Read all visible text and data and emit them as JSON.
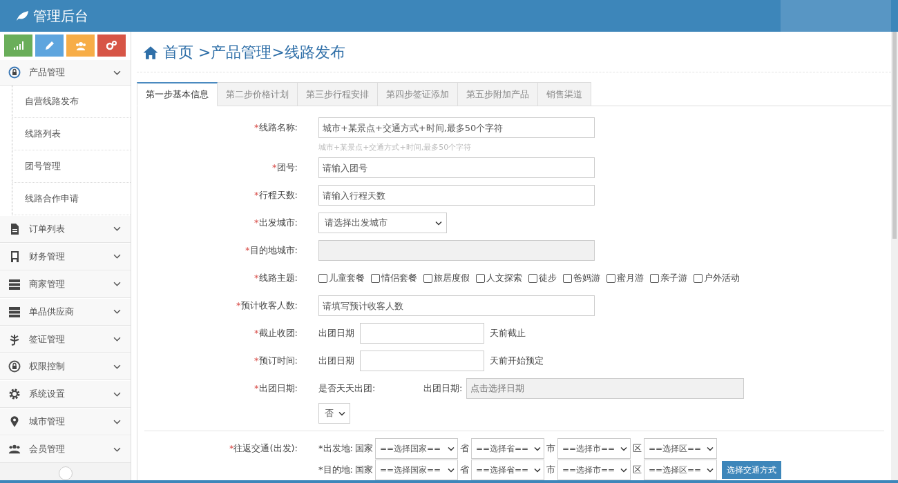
{
  "header": {
    "title": "管理后台"
  },
  "breadcrumb": "首页 >产品管理>线路发布",
  "sidebar": {
    "items": [
      {
        "label": "产品管理",
        "expanded": true,
        "children": [
          {
            "label": "自营线路发布"
          },
          {
            "label": "线路列表"
          },
          {
            "label": "团号管理"
          },
          {
            "label": "线路合作申请"
          }
        ]
      },
      {
        "label": "订单列表",
        "expanded": false
      },
      {
        "label": "财务管理",
        "expanded": false
      },
      {
        "label": "商家管理",
        "expanded": false
      },
      {
        "label": "单品供应商",
        "expanded": false
      },
      {
        "label": "签证管理",
        "expanded": false
      },
      {
        "label": "权限控制",
        "expanded": false
      },
      {
        "label": "系统设置",
        "expanded": false
      },
      {
        "label": "城市管理",
        "expanded": false
      },
      {
        "label": "会员管理",
        "expanded": false
      }
    ]
  },
  "tabs": [
    {
      "label": "第一步基本信息",
      "selected": true
    },
    {
      "label": "第二步价格计划",
      "selected": false
    },
    {
      "label": "第三步行程安排",
      "selected": false
    },
    {
      "label": "第四步签证添加",
      "selected": false
    },
    {
      "label": "第五步附加产品",
      "selected": false
    },
    {
      "label": "销售渠道",
      "selected": false
    }
  ],
  "form": [
    {
      "kind": "text",
      "required": "*",
      "label": "线路名称:",
      "placeholder": "城市+某景点+交通方式+时间,最多50个字符",
      "hint": "城市+某景点+交通方式+时间,最多50个字符"
    },
    {
      "kind": "text",
      "required": "*",
      "label": "团号:",
      "placeholder": "请输入团号"
    },
    {
      "kind": "text",
      "required": "*",
      "label": "行程天数:",
      "placeholder": "请输入行程天数"
    },
    {
      "kind": "select",
      "required": "*",
      "label": "出发城市:",
      "value": "请选择出发城市"
    },
    {
      "kind": "disabled",
      "required": "*",
      "label": "目的地城市:"
    },
    {
      "kind": "checkboxes",
      "required": "*",
      "label": "线路主题:",
      "options": [
        {
          "label": "儿童套餐",
          "checked": false
        },
        {
          "label": "情侣套餐",
          "checked": false
        },
        {
          "label": "旅居度假",
          "checked": false
        },
        {
          "label": "人文探索",
          "checked": false
        },
        {
          "label": "徒步",
          "checked": false
        },
        {
          "label": "爸妈游",
          "checked": false
        },
        {
          "label": "蜜月游",
          "checked": false
        },
        {
          "label": "亲子游",
          "checked": false
        },
        {
          "label": "户外活动",
          "checked": false
        }
      ]
    },
    {
      "kind": "text",
      "required": "*",
      "label": "预计收客人数:",
      "placeholder": "请填写预计收客人数"
    },
    {
      "kind": "days",
      "required": "*",
      "label": "截止收团:",
      "prefix": "出团日期",
      "suffix": "天前截止"
    },
    {
      "kind": "days",
      "required": "*",
      "label": "预订时间:",
      "prefix": "出团日期",
      "suffix": "天前开始预定"
    },
    {
      "kind": "date",
      "required": "*",
      "label": "出团日期:",
      "daily_label": "是否天天出团:",
      "daily_value": "否",
      "date_label": "出团日期:",
      "date_placeholder": "点击选择日期"
    }
  ],
  "transport": {
    "required": "*",
    "label": "往返交通(出发):",
    "rows": [
      {
        "prefix": "*出发地:",
        "selects": [
          {
            "label": "国家",
            "value": "==选择国家=="
          },
          {
            "label": "省",
            "value": "==选择省=="
          },
          {
            "label": "市",
            "value": "==选择市=="
          },
          {
            "label": "区",
            "value": "==选择区=="
          }
        ]
      },
      {
        "prefix": "*目的地:",
        "selects": [
          {
            "label": "国家",
            "value": "==选择国家=="
          },
          {
            "label": "省",
            "value": "==选择省=="
          },
          {
            "label": "市",
            "value": "==选择市=="
          },
          {
            "label": "区",
            "value": "==选择区=="
          }
        ],
        "button": "选择交通方式"
      }
    ]
  }
}
